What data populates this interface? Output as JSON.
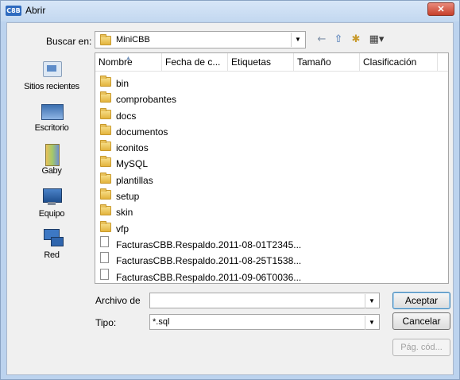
{
  "window": {
    "title": "Abrir",
    "app_icon_text": "C8B",
    "close_label": "✕"
  },
  "toolbar": {
    "look_in_label": "Buscar en:",
    "look_in_value": "MiniCBB",
    "combo_arrow": "▼",
    "back_glyph": "←",
    "up_glyph": "⇧",
    "new_folder_glyph": "✱",
    "views_glyph": "▦▾"
  },
  "places": [
    {
      "label": "Sitios recientes",
      "icon": "recent-places-icon"
    },
    {
      "label": "Escritorio",
      "icon": "desktop-icon"
    },
    {
      "label": "Gaby",
      "icon": "user-folder-icon"
    },
    {
      "label": "Equipo",
      "icon": "computer-icon"
    },
    {
      "label": "Red",
      "icon": "network-icon"
    }
  ],
  "columns": {
    "name": "Nombre",
    "date": "Fecha de c...",
    "tags": "Etiquetas",
    "size": "Tamaño",
    "rating": "Clasificación"
  },
  "files": [
    {
      "name": "bin",
      "type": "folder"
    },
    {
      "name": "comprobantes",
      "type": "folder"
    },
    {
      "name": "docs",
      "type": "folder"
    },
    {
      "name": "documentos",
      "type": "folder"
    },
    {
      "name": "iconitos",
      "type": "folder"
    },
    {
      "name": "MySQL",
      "type": "folder"
    },
    {
      "name": "plantillas",
      "type": "folder"
    },
    {
      "name": "setup",
      "type": "folder"
    },
    {
      "name": "skin",
      "type": "folder"
    },
    {
      "name": "vfp",
      "type": "folder"
    },
    {
      "name": "FacturasCBB.Respaldo.2011-08-01T2345...",
      "type": "file"
    },
    {
      "name": "FacturasCBB.Respaldo.2011-08-25T1538...",
      "type": "file"
    },
    {
      "name": "FacturasCBB.Respaldo.2011-09-06T0036...",
      "type": "file"
    }
  ],
  "filename": {
    "label": "Archivo de",
    "value": ""
  },
  "filetype": {
    "label": "Tipo:",
    "value": "*.sql"
  },
  "buttons": {
    "accept": "Aceptar",
    "cancel": "Cancelar",
    "codepage": "Pág. cód..."
  }
}
